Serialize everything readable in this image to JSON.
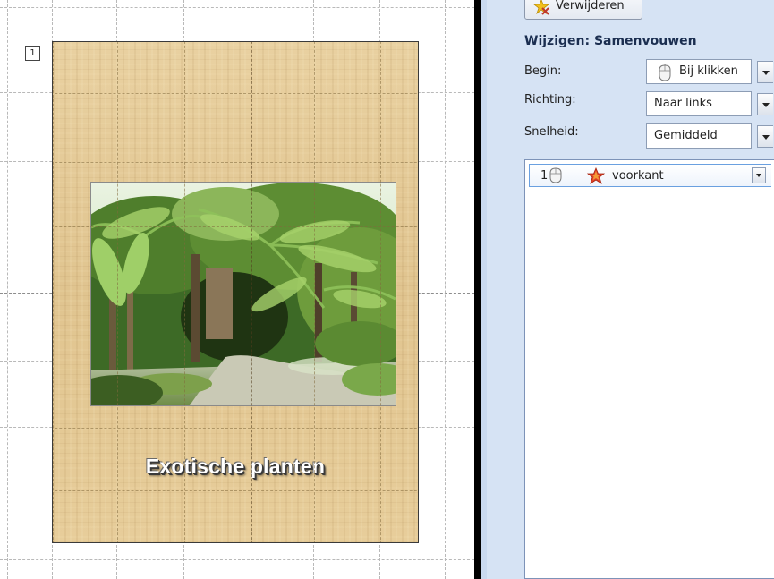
{
  "slide": {
    "page_number": "1",
    "title": "Exotische planten",
    "photo_icon": "tropical-garden-photo"
  },
  "task_pane": {
    "remove_button": "Verwijderen",
    "remove_icon": "remove-effect-icon",
    "modify_title": "Wijzigen: Samenvouwen",
    "fields": {
      "begin": {
        "label": "Begin:",
        "value": "Bij klikken",
        "icon": "mouse-icon"
      },
      "direction": {
        "label": "Richting:",
        "value": "Naar links"
      },
      "speed": {
        "label": "Snelheid:",
        "value": "Gemiddeld"
      }
    },
    "animation_list": [
      {
        "order": "1",
        "trigger_icon": "mouse-icon",
        "effect_icon": "star-icon",
        "name": "voorkant"
      }
    ]
  },
  "colors": {
    "pane_background": "#d6e3f4",
    "slide_background": "#e6cb98",
    "splitter": "#000000",
    "selection_border": "#6aa0e0"
  }
}
